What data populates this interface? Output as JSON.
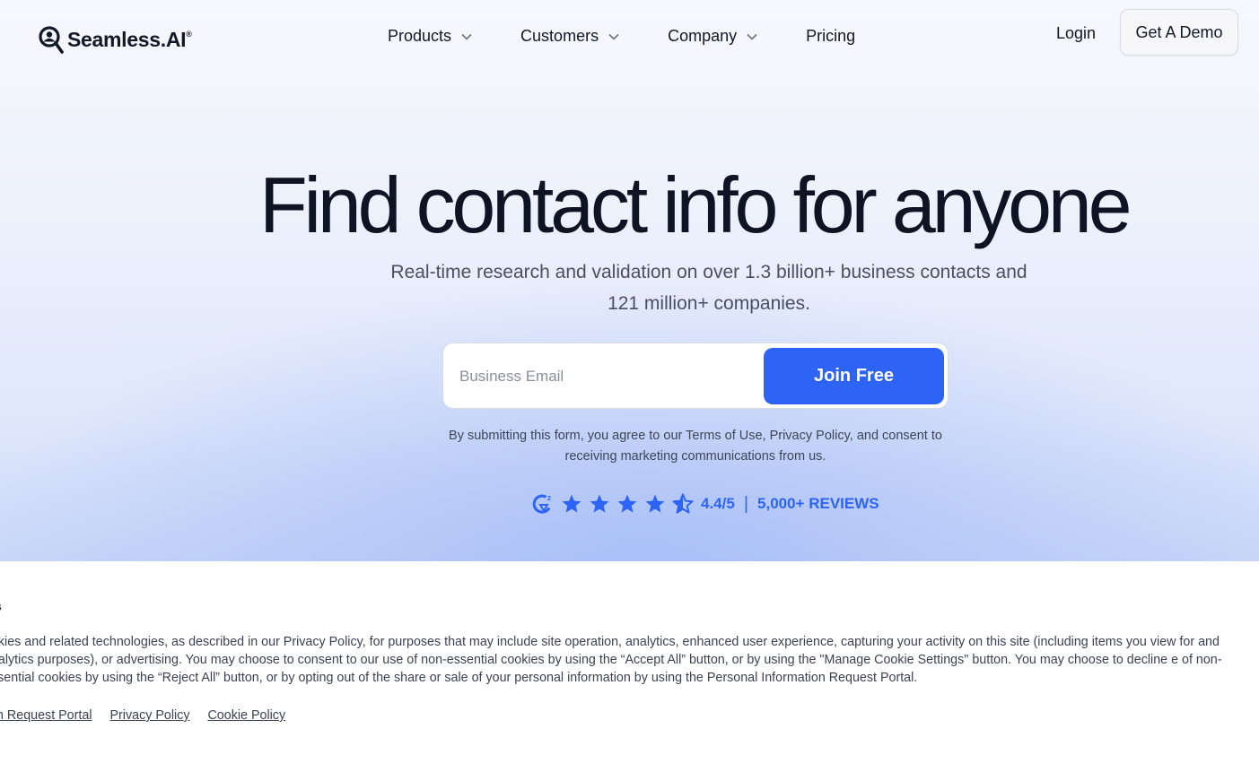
{
  "brand": {
    "name": "Seamless.AI",
    "mark": "®"
  },
  "nav": {
    "items": [
      {
        "label": "Products",
        "has_dropdown": true
      },
      {
        "label": "Customers",
        "has_dropdown": true
      },
      {
        "label": "Company",
        "has_dropdown": true
      },
      {
        "label": "Pricing",
        "has_dropdown": false
      }
    ],
    "login_label": "Login",
    "demo_label": "Get A Demo"
  },
  "hero": {
    "headline": "Find contact info for anyone",
    "subhead": "Real-time research and validation on over 1.3 billion+ business contacts and 121 million+ companies.",
    "email_placeholder": "Business Email",
    "join_label": "Join Free",
    "disclaimer": "By submitting this form, you agree to our Terms of Use, Privacy Policy, and consent to receiving marketing communications from us."
  },
  "rating": {
    "score": "4.4/5",
    "separator": "|",
    "reviews": "5,000+ REVIEWS",
    "stars": 4.5
  },
  "cookie_banner": {
    "title": "s",
    "text": "ookies and related technologies, as described in our Privacy Policy, for purposes that may include site operation, analytics, enhanced user experience, capturing your activity on this site (including items you view for  and analytics purposes), or advertising. You may choose to consent to our use of non-essential cookies by using the “Accept All” button, or by using the \"Manage Cookie Settings\" button. You may choose to decline e of non-essential cookies by using the “Reject All” button, or by opting out of the share or sale of your personal information by using the Personal Information Request Portal.",
    "links": [
      "n Request Portal",
      "Privacy Policy",
      "Cookie Policy"
    ]
  },
  "colors": {
    "accent": "#2e64f5",
    "text": "#0e1424"
  }
}
